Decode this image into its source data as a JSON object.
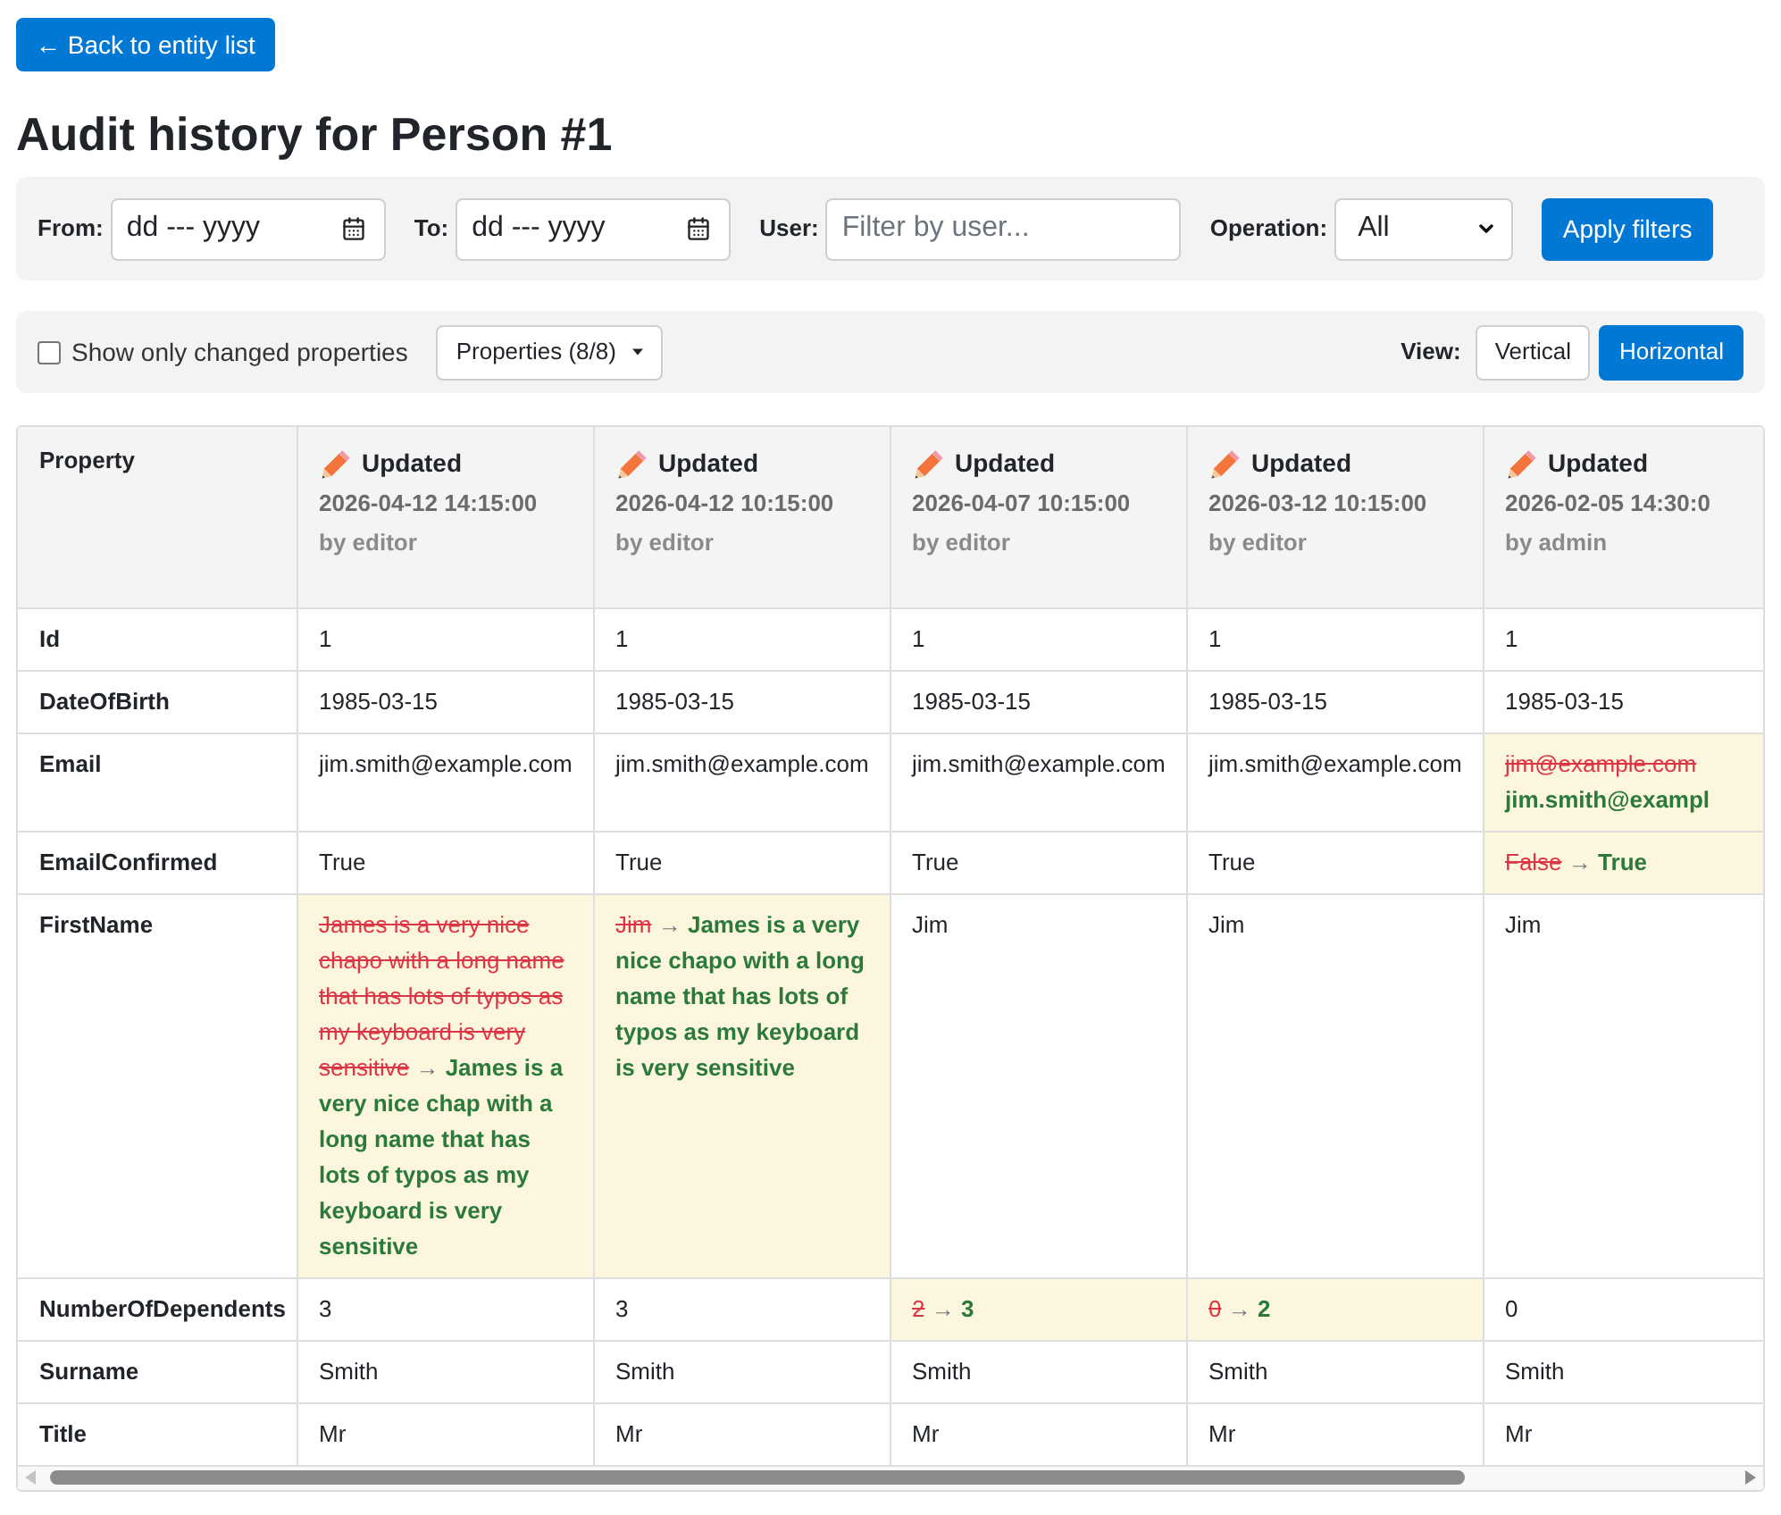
{
  "back_button": {
    "label": "← Back to entity list"
  },
  "title": "Audit history for Person #1",
  "filters": {
    "from": {
      "label": "From:",
      "placeholder": "dd --- yyyy"
    },
    "to": {
      "label": "To:",
      "placeholder": "dd --- yyyy"
    },
    "user": {
      "label": "User:",
      "placeholder": "Filter by user..."
    },
    "operation": {
      "label": "Operation:",
      "value": "All"
    },
    "apply_button": "Apply filters"
  },
  "view_bar": {
    "changed_only": {
      "label": "Show only changed properties",
      "checked": false
    },
    "properties_button": "Properties (8/8)",
    "view_label": "View:",
    "view_options": [
      {
        "label": "Vertical",
        "selected": false
      },
      {
        "label": "Horizontal",
        "selected": true
      }
    ]
  },
  "table": {
    "property_heading": "Property",
    "columns": [
      {
        "operation": "Updated",
        "timestamp": "2026-04-12 14:15:00",
        "user": "by editor"
      },
      {
        "operation": "Updated",
        "timestamp": "2026-04-12 10:15:00",
        "user": "by editor"
      },
      {
        "operation": "Updated",
        "timestamp": "2026-04-07 10:15:00",
        "user": "by editor"
      },
      {
        "operation": "Updated",
        "timestamp": "2026-03-12 10:15:00",
        "user": "by editor"
      },
      {
        "operation": "Updated",
        "timestamp": "2026-02-05 14:30:0",
        "user": "by admin"
      }
    ],
    "rows": [
      {
        "property": "Id",
        "cells": [
          {
            "changed": false,
            "value": "1"
          },
          {
            "changed": false,
            "value": "1"
          },
          {
            "changed": false,
            "value": "1"
          },
          {
            "changed": false,
            "value": "1"
          },
          {
            "changed": false,
            "value": "1"
          }
        ]
      },
      {
        "property": "DateOfBirth",
        "cells": [
          {
            "changed": false,
            "value": "1985-03-15"
          },
          {
            "changed": false,
            "value": "1985-03-15"
          },
          {
            "changed": false,
            "value": "1985-03-15"
          },
          {
            "changed": false,
            "value": "1985-03-15"
          },
          {
            "changed": false,
            "value": "1985-03-15"
          }
        ]
      },
      {
        "property": "Email",
        "cells": [
          {
            "changed": false,
            "value": "jim.smith@example.com"
          },
          {
            "changed": false,
            "value": "jim.smith@example.com"
          },
          {
            "changed": false,
            "value": "jim.smith@example.com"
          },
          {
            "changed": false,
            "value": "jim.smith@example.com"
          },
          {
            "changed": true,
            "old": "jim@example.com",
            "new": "jim.smith@exampl"
          }
        ]
      },
      {
        "property": "EmailConfirmed",
        "cells": [
          {
            "changed": false,
            "value": "True"
          },
          {
            "changed": false,
            "value": "True"
          },
          {
            "changed": false,
            "value": "True"
          },
          {
            "changed": false,
            "value": "True"
          },
          {
            "changed": true,
            "old": "False",
            "arrow": "→",
            "new": "True"
          }
        ]
      },
      {
        "property": "FirstName",
        "cells": [
          {
            "changed": true,
            "old": "James is a very nice chapo with a long name that has lots of typos as my keyboard is very sensitive",
            "arrow": "→",
            "new": "James is a very nice chap with a long name that has lots of typos as my keyboard is very sensitive"
          },
          {
            "changed": true,
            "old": "Jim",
            "arrow": "→",
            "new": "James is a very nice chapo with a long name that has lots of typos as my keyboard is very sensitive"
          },
          {
            "changed": false,
            "value": "Jim"
          },
          {
            "changed": false,
            "value": "Jim"
          },
          {
            "changed": false,
            "value": "Jim"
          }
        ]
      },
      {
        "property": "NumberOfDependents",
        "cells": [
          {
            "changed": false,
            "value": "3"
          },
          {
            "changed": false,
            "value": "3"
          },
          {
            "changed": true,
            "old": "2",
            "arrow": "→",
            "new": "3"
          },
          {
            "changed": true,
            "old": "0",
            "arrow": "→",
            "new": "2"
          },
          {
            "changed": false,
            "value": "0"
          }
        ]
      },
      {
        "property": "Surname",
        "cells": [
          {
            "changed": false,
            "value": "Smith"
          },
          {
            "changed": false,
            "value": "Smith"
          },
          {
            "changed": false,
            "value": "Smith"
          },
          {
            "changed": false,
            "value": "Smith"
          },
          {
            "changed": false,
            "value": "Smith"
          }
        ]
      },
      {
        "property": "Title",
        "cells": [
          {
            "changed": false,
            "value": "Mr"
          },
          {
            "changed": false,
            "value": "Mr"
          },
          {
            "changed": false,
            "value": "Mr"
          },
          {
            "changed": false,
            "value": "Mr"
          },
          {
            "changed": false,
            "value": "Mr"
          }
        ]
      }
    ]
  }
}
